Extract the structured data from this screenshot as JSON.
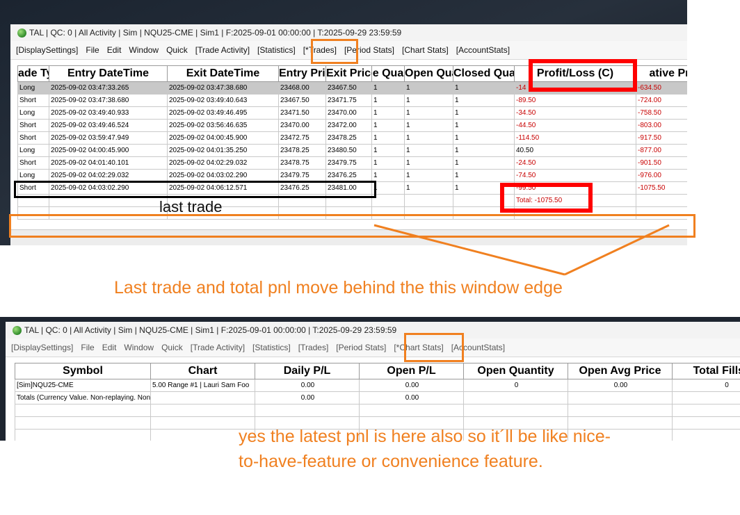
{
  "colors": {
    "annotation_orange": "#f08020",
    "highlight_red": "#ff0000",
    "loss_red": "#c80000"
  },
  "top_window": {
    "title": "TAL | QC: 0 | All Activity | Sim | NQU25-CME | Sim1 | F:2025-09-01  00:00:00 | T:2025-09-29  23:59:59",
    "menu": [
      "[DisplaySettings]",
      "File",
      "Edit",
      "Window",
      "Quick",
      "[Trade Activity]",
      "[Statistics]",
      "[*Trades]",
      "[Period Stats]",
      "[Chart Stats]",
      "[AccountStats]"
    ],
    "headers": [
      "ade Ty",
      "Entry DateTime",
      "Exit DateTime",
      "Entry Pric",
      "Exit Price",
      "e Qua",
      "Open Qua",
      "Closed Qua",
      "Profit/Loss (C)",
      "ative Prof"
    ],
    "rows": [
      [
        "Long",
        "2025-09-02  03:47:33.265",
        "2025-09-02  03:47:38.680",
        "23468.00",
        "23467.50",
        "1",
        "1",
        "1",
        "-14",
        "-634.50"
      ],
      [
        "Short",
        "2025-09-02  03:47:38.680",
        "2025-09-02  03:49:40.643",
        "23467.50",
        "23471.75",
        "1",
        "1",
        "1",
        "-89.50",
        "-724.00"
      ],
      [
        "Long",
        "2025-09-02  03:49:40.933",
        "2025-09-02  03:49:46.495",
        "23471.50",
        "23470.00",
        "1",
        "1",
        "1",
        "-34.50",
        "-758.50"
      ],
      [
        "Short",
        "2025-09-02  03:49:46.524",
        "2025-09-02  03:56:46.635",
        "23470.00",
        "23472.00",
        "1",
        "1",
        "1",
        "-44.50",
        "-803.00"
      ],
      [
        "Short",
        "2025-09-02  03:59:47.949",
        "2025-09-02  04:00:45.900",
        "23472.75",
        "23478.25",
        "1",
        "1",
        "1",
        "-114.50",
        "-917.50"
      ],
      [
        "Long",
        "2025-09-02  04:00:45.900",
        "2025-09-02  04:01:35.250",
        "23478.25",
        "23480.50",
        "1",
        "1",
        "1",
        "40.50",
        "-877.00"
      ],
      [
        "Short",
        "2025-09-02  04:01:40.101",
        "2025-09-02  04:02:29.032",
        "23478.75",
        "23479.75",
        "1",
        "1",
        "1",
        "-24.50",
        "-901.50"
      ],
      [
        "Long",
        "2025-09-02  04:02:29.032",
        "2025-09-02  04:03:02.290",
        "23479.75",
        "23476.25",
        "1",
        "1",
        "1",
        "-74.50",
        "-976.00"
      ],
      [
        "Short",
        "2025-09-02  04:03:02.290",
        "2025-09-02  04:06:12.571",
        "23476.25",
        "23481.00",
        "1",
        "1",
        "1",
        "-99.50",
        "-1075.50"
      ]
    ],
    "total_label": "Total: -1075.50"
  },
  "annotations": {
    "last_trade": "last trade",
    "note1": "Last trade and total pnl move behind the this window edge",
    "note2_line1": "yes the latest pnl is here also so it´ll be like nice-",
    "note2_line2": "to-have-feature or convenience feature."
  },
  "bottom_window": {
    "title": "TAL | QC: 0 | All Activity | Sim | NQU25-CME | Sim1 | F:2025-09-01  00:00:00 | T:2025-09-29  23:59:59",
    "menu": [
      "[DisplaySettings]",
      "File",
      "Edit",
      "Window",
      "Quick",
      "[Trade Activity]",
      "[Statistics]",
      "[Trades]",
      "[Period Stats]",
      "[*Chart Stats]",
      "[AccountStats]"
    ],
    "headers": [
      "Symbol",
      "Chart",
      "Daily P/L",
      "Open P/L",
      "Open Quantity",
      "Open Avg Price",
      "Total Fills (B"
    ],
    "rows": [
      [
        "[Sim]NQU25-CME",
        "5.00 Range  #1 | Lauri Sam Foo",
        "0.00",
        "0.00",
        "0",
        "0.00",
        "0"
      ],
      [
        "Totals (Currency Value. Non-replaying. Non-",
        "",
        "0.00",
        "0.00",
        "",
        "",
        ""
      ]
    ]
  }
}
